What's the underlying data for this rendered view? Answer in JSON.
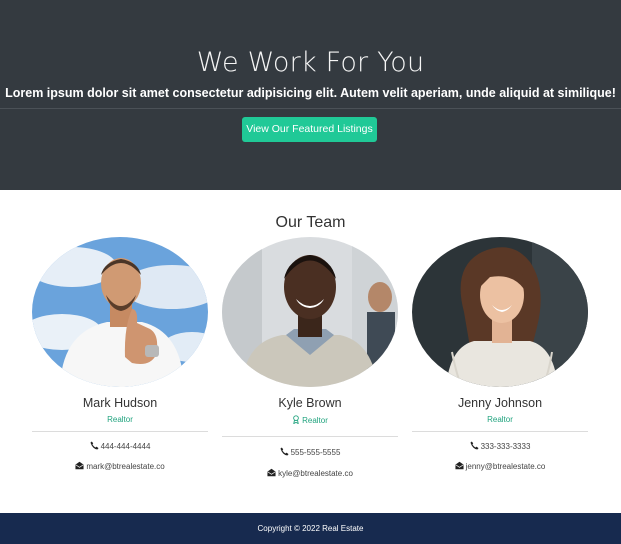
{
  "hero": {
    "title": "We Work For You",
    "subtitle": "Lorem ipsum dolor sit amet consectetur adipisicing elit. Autem velit aperiam, unde aliquid at similique!",
    "button_label": "View Our Featured Listings"
  },
  "team": {
    "title": "Our Team",
    "members": [
      {
        "name": "Mark Hudson",
        "role": "Realtor",
        "phone": "444-444-4444",
        "email": "mark@btrealestate.co"
      },
      {
        "name": "Kyle Brown",
        "role": "Realtor",
        "phone": "555-555-5555",
        "email": "kyle@btrealestate.co"
      },
      {
        "name": "Jenny Johnson",
        "role": "Realtor",
        "phone": "333-333-3333",
        "email": "jenny@btrealestate.co"
      }
    ]
  },
  "footer": {
    "copyright": "Copyright © 2022 Real Estate"
  },
  "colors": {
    "hero_bg": "#343a40",
    "accent": "#20c997",
    "footer_bg": "#172a4f"
  }
}
